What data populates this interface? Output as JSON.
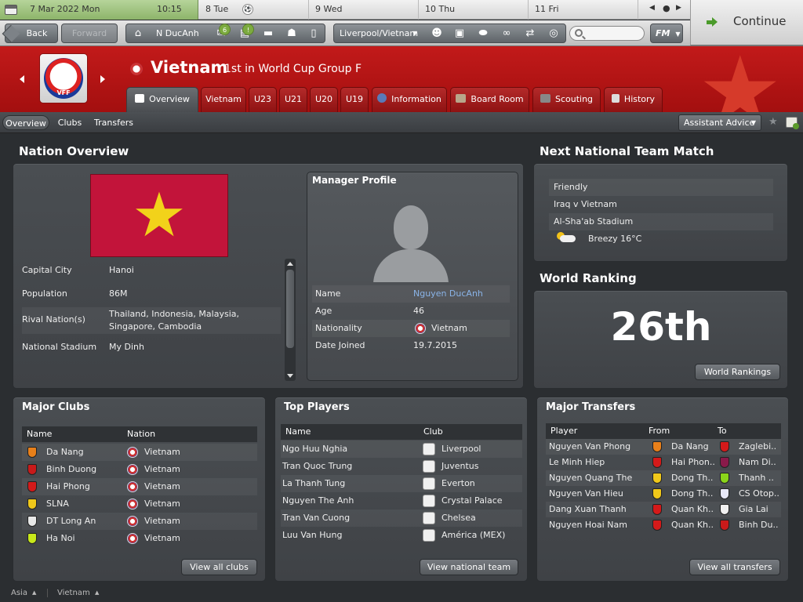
{
  "calendar": {
    "current_date": "7 Mar 2022  Mon",
    "current_time": "10:15",
    "days": [
      "8  Tue",
      "9  Wed",
      "10  Thu",
      "11  Fri"
    ],
    "match_marker": "⚽"
  },
  "toolbar": {
    "back_label": "Back",
    "forward_label": "Forward",
    "manager_label": "N DucAnh",
    "inbox_badge": "6",
    "news_badge": "!",
    "club_label": "Liverpool/Vietnam",
    "search_placeholder": "",
    "fm_label": "FM",
    "continue_label": "Continue"
  },
  "header": {
    "title": "Vietnam",
    "subtitle": "1st in World Cup Group F",
    "crest_text": "VFF",
    "tabs": [
      "Overview",
      "Vietnam",
      "U23",
      "U21",
      "U20",
      "U19",
      "Information",
      "Board Room",
      "Scouting",
      "History"
    ]
  },
  "subnav": {
    "tabs": [
      "Overview",
      "Clubs",
      "Transfers"
    ],
    "assistant_label": "Assistant Advice"
  },
  "nation_overview": {
    "title": "Nation Overview",
    "rows": [
      {
        "label": "Capital City",
        "value": "Hanoi"
      },
      {
        "label": "Population",
        "value": "86M"
      },
      {
        "label": "Rival Nation(s)",
        "value": "Thailand, Indonesia, Malaysia, Singapore, Cambodia"
      },
      {
        "label": "National Stadium",
        "value": "My Dinh"
      }
    ]
  },
  "manager_profile": {
    "title": "Manager Profile",
    "rows": [
      {
        "label": "Name",
        "value": "Nguyen DucAnh"
      },
      {
        "label": "Age",
        "value": "46"
      },
      {
        "label": "Nationality",
        "value": "Vietnam"
      },
      {
        "label": "Date Joined",
        "value": "19.7.2015"
      }
    ]
  },
  "next_match": {
    "title": "Next National Team Match",
    "competition": "Friendly",
    "fixture": "Iraq v Vietnam",
    "venue": "Al-Sha'ab Stadium",
    "weather": "Breezy 16°C"
  },
  "world_ranking": {
    "title": "World Ranking",
    "value": "26th",
    "button_label": "World Rankings"
  },
  "major_clubs": {
    "title": "Major Clubs",
    "headers": [
      "Name",
      "Nation"
    ],
    "rows": [
      {
        "name": "Da Nang",
        "nation": "Vietnam",
        "color": "#e8801a"
      },
      {
        "name": "Binh Duong",
        "nation": "Vietnam",
        "color": "#c81a1a"
      },
      {
        "name": "Hai Phong",
        "nation": "Vietnam",
        "color": "#d41a1a"
      },
      {
        "name": "SLNA",
        "nation": "Vietnam",
        "color": "#f0c81a"
      },
      {
        "name": "DT Long An",
        "nation": "Vietnam",
        "color": "#e8e8e8"
      },
      {
        "name": "Ha Noi",
        "nation": "Vietnam",
        "color": "#c8e81a"
      }
    ],
    "button_label": "View all clubs"
  },
  "top_players": {
    "title": "Top Players",
    "headers": [
      "Name",
      "Club"
    ],
    "rows": [
      {
        "name": "Ngo Huu Nghia",
        "club": "Liverpool"
      },
      {
        "name": "Tran Quoc Trung",
        "club": "Juventus"
      },
      {
        "name": "La Thanh Tung",
        "club": "Everton"
      },
      {
        "name": "Nguyen The Anh",
        "club": "Crystal Palace"
      },
      {
        "name": "Tran Van Cuong",
        "club": "Chelsea"
      },
      {
        "name": "Luu Van Hung",
        "club": "América (MEX)"
      }
    ],
    "button_label": "View national team"
  },
  "major_transfers": {
    "title": "Major Transfers",
    "headers": [
      "Player",
      "From",
      "To"
    ],
    "rows": [
      {
        "player": "Nguyen Van Phong",
        "from": "Da Nang",
        "to": "Zaglebi..",
        "from_color": "#e8801a",
        "to_color": "#d41a1a"
      },
      {
        "player": "Le Minh Hiep",
        "from": "Hai Phon..",
        "to": "Nam Di..",
        "from_color": "#d41a1a",
        "to_color": "#8a1a4a"
      },
      {
        "player": "Nguyen Quang The",
        "from": "Dong Th..",
        "to": "Thanh ..",
        "from_color": "#f0c81a",
        "to_color": "#8ad41a"
      },
      {
        "player": "Nguyen Van Hieu",
        "from": "Dong Th..",
        "to": "CS Otop..",
        "from_color": "#f0c81a",
        "to_color": "#e8e8f8"
      },
      {
        "player": "Dang Xuan Thanh",
        "from": "Quan Kh..",
        "to": "Gia Lai",
        "from_color": "#d41a1a",
        "to_color": "#f0f0f0"
      },
      {
        "player": "Nguyen Hoai Nam",
        "from": "Quan Kh..",
        "to": "Binh Du..",
        "from_color": "#d41a1a",
        "to_color": "#c81a1a"
      }
    ],
    "button_label": "View all transfers"
  },
  "footer": {
    "region": "Asia",
    "nation": "Vietnam"
  },
  "colors": {
    "header_red": "#b51616",
    "panel": "#44484c",
    "link_blue": "#8ab4e8",
    "vietnam_flag_red": "#c2143a",
    "vietnam_flag_star": "#f2d21a"
  }
}
